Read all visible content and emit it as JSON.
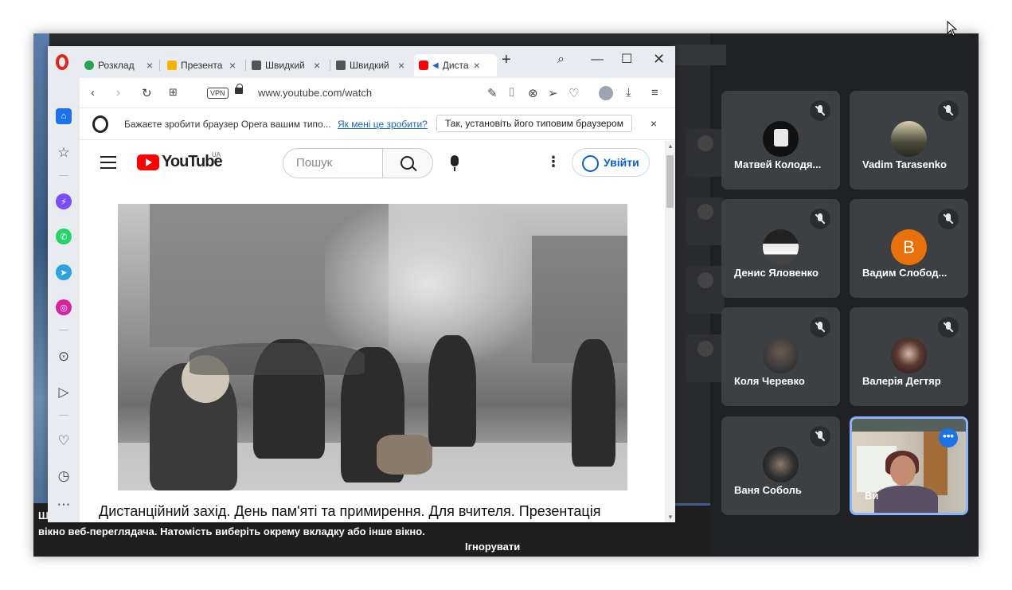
{
  "browser": {
    "tabs": [
      {
        "title": "Розклад",
        "favicon_color": "#23a455"
      },
      {
        "title": "Презента",
        "favicon_color": "#f4b400"
      },
      {
        "title": "Швидкий",
        "favicon_color": "#555555"
      },
      {
        "title": "Швидкий",
        "favicon_color": "#555555"
      },
      {
        "title": "Диста",
        "favicon_color": "#ff0000",
        "active": true
      }
    ],
    "url": "www.youtube.com/watch",
    "vpn_label": "VPN",
    "notification": {
      "message": "Бажаєте зробити браузер Opera вашим типо...",
      "link": "Як мені це зробити?",
      "button": "Так, установіть його типовим браузером"
    }
  },
  "youtube": {
    "logo_text": "YouTube",
    "region": "UA",
    "search_placeholder": "Пошук",
    "login_label": "Увійти",
    "video_title": "Дистанційний захід. День пам'яті та примирення. Для вчителя. Презентація"
  },
  "presenting": {
    "message_prefix": "Ш",
    "message": "вікно веб-переглядача. Натомість виберіть окрему вкладку або інше вікно.",
    "ignore_label": "Ігнорувати"
  },
  "participants": [
    {
      "name": "Матвей Колодя...",
      "avatar_color": "#111111",
      "muted": true
    },
    {
      "name": "Vadim Tarasenko",
      "avatar_color": "#4a4a38",
      "muted": true
    },
    {
      "name": "Денис Яловенко",
      "avatar_color": "#e8e8e8",
      "muted": true
    },
    {
      "name": "Вадим Слобод...",
      "avatar_color": "#e8710a",
      "initial": "В",
      "muted": true
    },
    {
      "name": "Коля Черевко",
      "avatar_color": "#3a3a3a",
      "muted": true
    },
    {
      "name": "Валерія Дегтяр",
      "avatar_color": "#2a2020",
      "muted": true
    },
    {
      "name": "Ваня Соболь",
      "avatar_color": "#1e1e1e",
      "muted": true
    },
    {
      "name": "Ви",
      "self": true,
      "more_label": "•••"
    }
  ]
}
